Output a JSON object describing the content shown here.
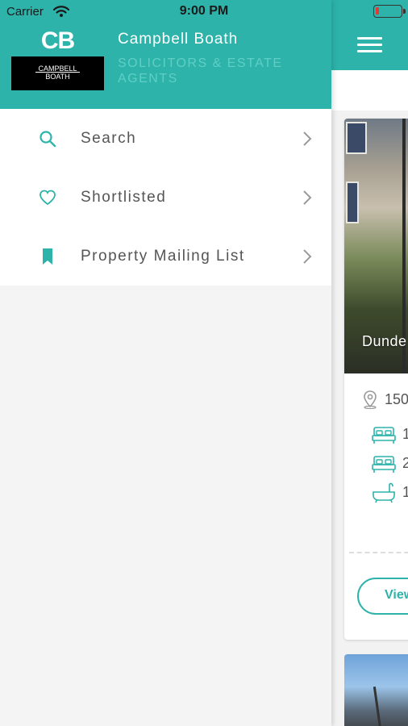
{
  "status_bar": {
    "carrier": "Carrier",
    "time": "9:00 PM",
    "battery_color": "#e53935"
  },
  "drawer": {
    "logo": {
      "initials": "CB",
      "name_line1": "CAMPBELL",
      "name_line2": "BOATH"
    },
    "company_name": "Campbell Boath",
    "company_subtitle": "SOLICITORS & ESTATE AGENTS",
    "menu": [
      {
        "label": "Search",
        "icon": "search-icon"
      },
      {
        "label": "Shortlisted",
        "icon": "heart-icon"
      },
      {
        "label": "Property Mailing List",
        "icon": "bookmark-icon"
      }
    ]
  },
  "main": {
    "card": {
      "caption": "Dunde",
      "address": "150",
      "features": [
        "1",
        "2",
        "1"
      ],
      "view_label": "View"
    }
  },
  "colors": {
    "accent": "#2db3aa",
    "accent_light": "#5fcfc6"
  }
}
